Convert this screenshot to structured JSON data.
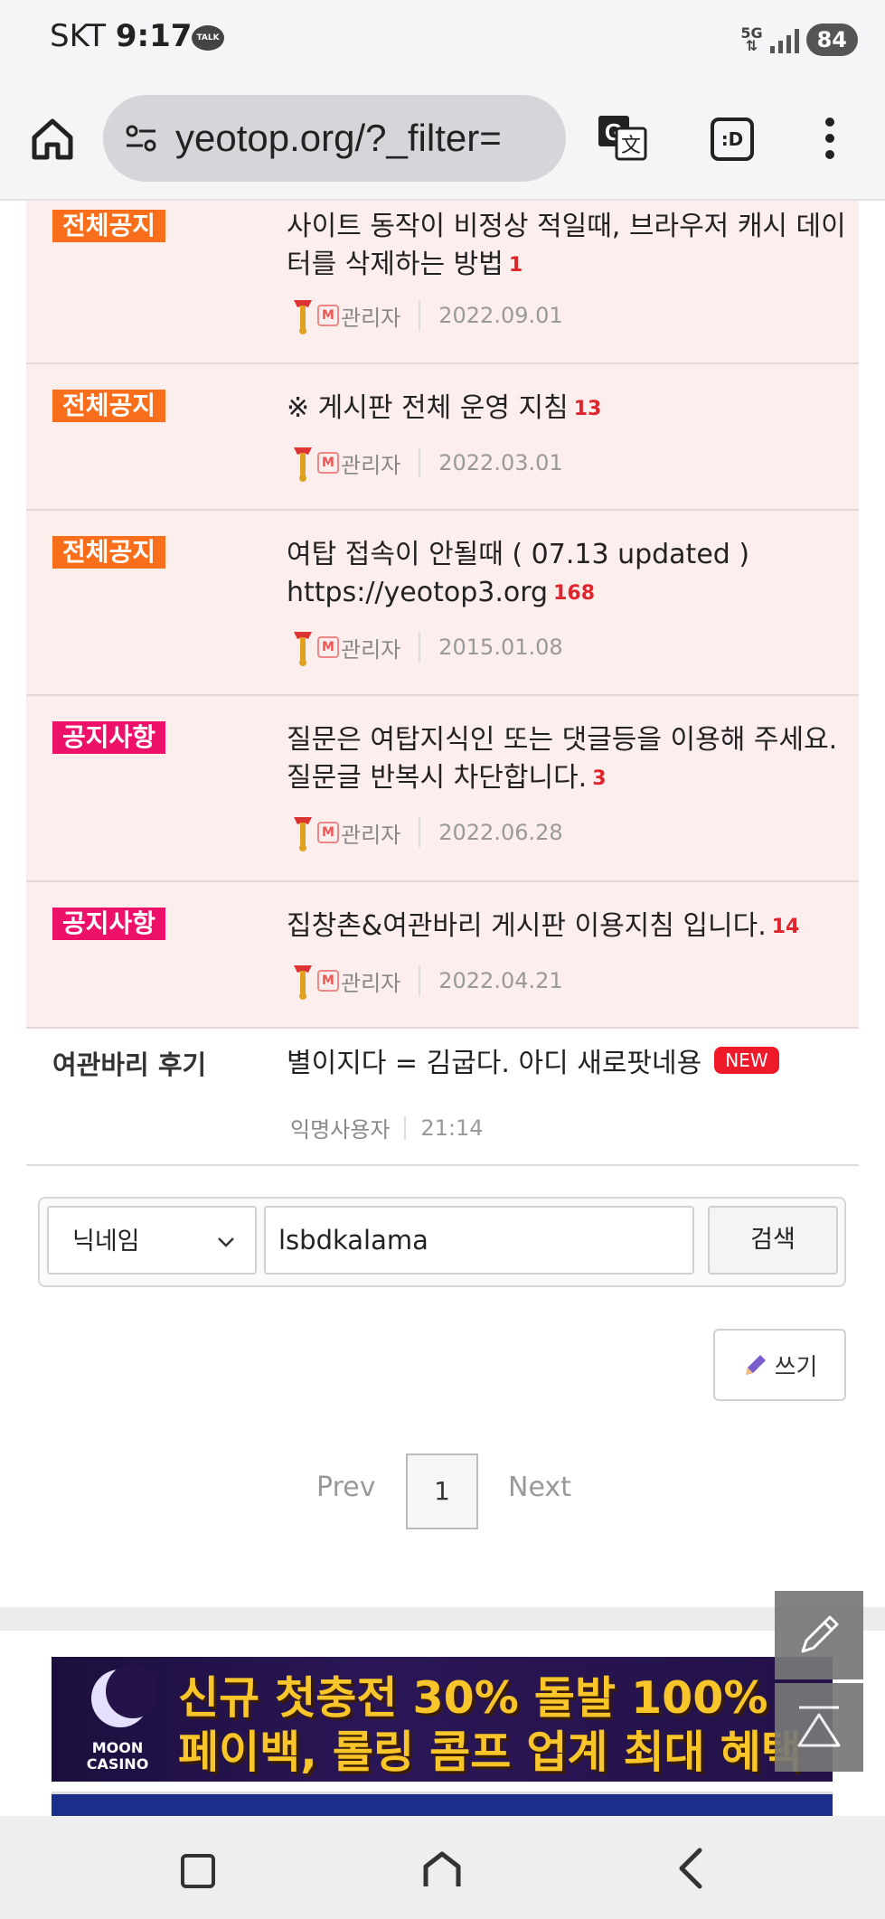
{
  "status_bar": {
    "carrier": "SKT",
    "time": "9:17",
    "talk_badge": "TALK",
    "network": "5G",
    "battery": "84"
  },
  "browser": {
    "url": "yeotop.org/?_filter=",
    "tabs_label": ":D"
  },
  "posts": [
    {
      "category": "전체공지",
      "category_style": "notice-all",
      "title": "사이트 동작이 비정상 적일때, 브라우저 캐시 데이터를 삭제하는 방법",
      "comments": "1",
      "author": "관리자",
      "date": "2022.09.01",
      "has_admin_icons": true
    },
    {
      "category": "전체공지",
      "category_style": "notice-all",
      "title": "※ 게시판 전체 운영 지침",
      "comments": "13",
      "author": "관리자",
      "date": "2022.03.01",
      "has_admin_icons": true
    },
    {
      "category": "전체공지",
      "category_style": "notice-all",
      "title": "여탑 접속이 안될때 ( 07.13 updated ) https://yeotop3.org",
      "comments": "168",
      "author": "관리자",
      "date": "2015.01.08",
      "has_admin_icons": true
    },
    {
      "category": "공지사항",
      "category_style": "notice",
      "title": "질문은 여탑지식인 또는 댓글등을 이용해 주세요. 질문글 반복시 차단합니다.",
      "comments": "3",
      "author": "관리자",
      "date": "2022.06.28",
      "has_admin_icons": true
    },
    {
      "category": "공지사항",
      "category_style": "notice",
      "title": "집창촌&여관바리 게시판 이용지침 입니다.",
      "comments": "14",
      "author": "관리자",
      "date": "2022.04.21",
      "has_admin_icons": true
    },
    {
      "category": "여관바리 후기",
      "category_style": "plain",
      "title": "별이지다 = 김굽다. 아디 새로팟네용",
      "badge": "NEW",
      "author": "익명사용자",
      "date": "21:14",
      "has_admin_icons": false
    }
  ],
  "search": {
    "field_selected": "닉네임",
    "query": "lsbdkalama",
    "button": "검색"
  },
  "write_button": "쓰기",
  "pagination": {
    "prev": "Prev",
    "current": "1",
    "next": "Next"
  },
  "banner": {
    "brand_line1": "MOON",
    "brand_line2": "CASINO",
    "line1": "신규 첫충전 30% 돌발 100%",
    "line2": "페이백, 롤링 콤프 업계 최대 혜택"
  },
  "colors": {
    "notice_all": "#f96e1a",
    "notice": "#ee1169",
    "notice_row_bg": "#fdeeee",
    "count_red": "#e0242c",
    "new_badge": "#ee1a2a",
    "banner_text": "#f8c62a"
  }
}
